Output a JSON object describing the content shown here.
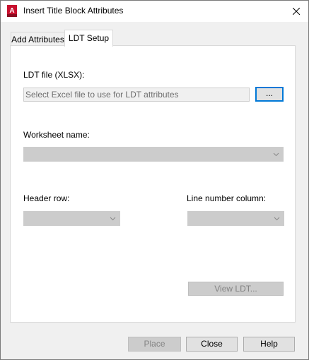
{
  "window": {
    "title": "Insert Title Block Attributes",
    "app_icon": "autocad-app-icon",
    "app_icon_letter": "A",
    "close_glyph": "✕"
  },
  "tabs": [
    {
      "label": "Add Attributes",
      "active": false
    },
    {
      "label": "LDT Setup",
      "active": true
    }
  ],
  "ldt_setup": {
    "ldt_file_label": "LDT file (XLSX):",
    "ldt_file_placeholder": "Select Excel file to use for LDT attributes",
    "browse_label": "...",
    "worksheet_label": "Worksheet name:",
    "worksheet_value": "",
    "header_row_label": "Header row:",
    "header_row_value": "",
    "line_number_label": "Line number column:",
    "line_number_value": "",
    "view_ldt_label": "View LDT..."
  },
  "footer": {
    "place_label": "Place",
    "close_label": "Close",
    "help_label": "Help"
  },
  "colors": {
    "accent": "#0078d7",
    "app_icon_red": "#c8102e",
    "disabled_bg": "#cccccc",
    "disabled_text": "#838383"
  }
}
